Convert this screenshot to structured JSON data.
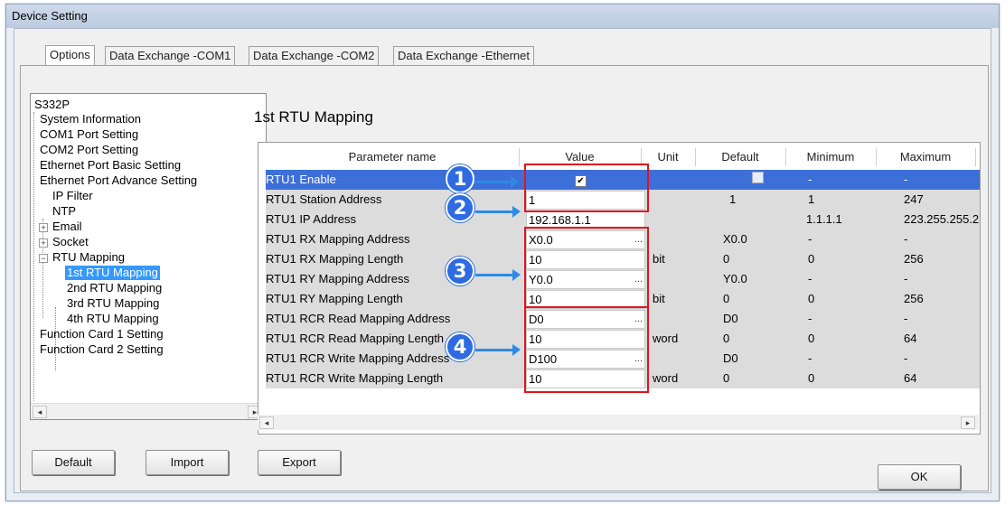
{
  "window": {
    "title": "Device Setting"
  },
  "tabs": [
    {
      "label": "Options",
      "active": true
    },
    {
      "label": "Data Exchange -COM1",
      "active": false
    },
    {
      "label": "Data Exchange -COM2",
      "active": false
    },
    {
      "label": "Data Exchange -Ethernet",
      "active": false
    }
  ],
  "tree": {
    "root": "S332P",
    "items": [
      "System Information",
      "COM1 Port Setting",
      "COM2 Port Setting",
      "Ethernet Port Basic Setting",
      "Ethernet Port Advance Setting",
      "IP Filter",
      "NTP",
      "Email",
      "Socket",
      "RTU Mapping",
      "1st RTU Mapping",
      "2nd RTU Mapping",
      "3rd RTU Mapping",
      "4th RTU Mapping",
      "Function Card 1 Setting",
      "Function Card 2 Setting"
    ],
    "selected": "1st RTU Mapping"
  },
  "section": {
    "title": "1st RTU Mapping"
  },
  "grid": {
    "headers": {
      "name": "Parameter name",
      "value": "Value",
      "unit": "Unit",
      "default": "Default",
      "min": "Minimum",
      "max": "Maximum"
    },
    "rows": [
      {
        "name": "RTU1 Enable",
        "value": "✔",
        "unit": "",
        "default": "",
        "min": "-",
        "max": "-"
      },
      {
        "name": "RTU1 Station Address",
        "value": "1",
        "unit": "",
        "default": "1",
        "min": "1",
        "max": "247"
      },
      {
        "name": "RTU1 IP Address",
        "value": "192.168.1.1",
        "unit": "",
        "default": "",
        "min": "1.1.1.1",
        "max": "223.255.255.2"
      },
      {
        "name": "RTU1 RX Mapping Address",
        "value": "X0.0",
        "unit": "",
        "default": "X0.0",
        "min": "-",
        "max": "-"
      },
      {
        "name": "RTU1 RX Mapping Length",
        "value": "10",
        "unit": "bit",
        "default": "0",
        "min": "0",
        "max": "256"
      },
      {
        "name": "RTU1 RY Mapping Address",
        "value": "Y0.0",
        "unit": "",
        "default": "Y0.0",
        "min": "-",
        "max": "-"
      },
      {
        "name": "RTU1 RY Mapping Length",
        "value": "10",
        "unit": "bit",
        "default": "0",
        "min": "0",
        "max": "256"
      },
      {
        "name": "RTU1 RCR Read Mapping Address",
        "value": "D0",
        "unit": "",
        "default": "D0",
        "min": "-",
        "max": "-"
      },
      {
        "name": "RTU1 RCR Read Mapping Length",
        "value": "10",
        "unit": "word",
        "default": "0",
        "min": "0",
        "max": "64"
      },
      {
        "name": "RTU1 RCR Write Mapping Address",
        "value": "D100",
        "unit": "",
        "default": "D0",
        "min": "-",
        "max": "-"
      },
      {
        "name": "RTU1 RCR Write Mapping Length",
        "value": "10",
        "unit": "word",
        "default": "0",
        "min": "0",
        "max": "64"
      }
    ]
  },
  "callouts": [
    "1",
    "2",
    "3",
    "4"
  ],
  "buttons": {
    "default": "Default",
    "import": "Import",
    "export": "Export",
    "ok": "OK"
  },
  "icons": {
    "ellipsis": "...",
    "scroll_left": "◂",
    "scroll_right": "▸",
    "expand": "+",
    "collapse": "−"
  },
  "colors": {
    "selection": "#3d6fd8",
    "highlight_box": "#e0141e",
    "callout": "#2e6be0"
  }
}
